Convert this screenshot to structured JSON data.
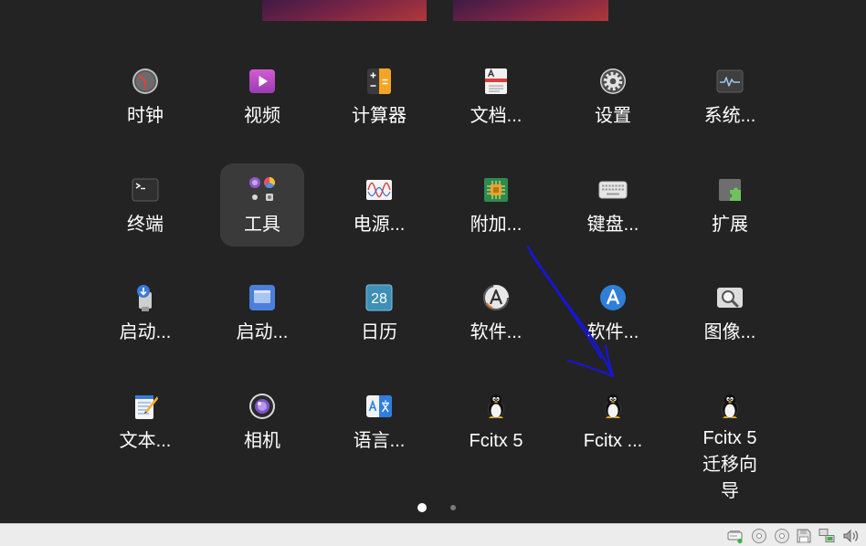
{
  "app_grid": {
    "apps": [
      {
        "label": "时钟",
        "icon": "clock-icon"
      },
      {
        "label": "视频",
        "icon": "videos-icon"
      },
      {
        "label": "计算器",
        "icon": "calculator-icon"
      },
      {
        "label": "文档...",
        "icon": "document-viewer-icon"
      },
      {
        "label": "设置",
        "icon": "settings-gear-icon"
      },
      {
        "label": "系统...",
        "icon": "system-monitor-icon"
      },
      {
        "label": "终端",
        "icon": "terminal-icon"
      },
      {
        "label": "工具",
        "icon": "folder-grid-icon",
        "highlighted": true
      },
      {
        "label": "电源...",
        "icon": "power-statistics-icon"
      },
      {
        "label": "附加...",
        "icon": "driver-chip-icon"
      },
      {
        "label": "键盘...",
        "icon": "keyboard-icon"
      },
      {
        "label": "扩展",
        "icon": "puzzle-extension-icon"
      },
      {
        "label": "启动...",
        "icon": "usb-disk-creator-icon"
      },
      {
        "label": "启动...",
        "icon": "startup-window-icon"
      },
      {
        "label": "日历",
        "icon": "calendar-icon",
        "icon_text": "28"
      },
      {
        "label": "软件...",
        "icon": "software-updater-icon"
      },
      {
        "label": "软件...",
        "icon": "software-store-icon"
      },
      {
        "label": "图像...",
        "icon": "image-viewer-icon"
      },
      {
        "label": "文本...",
        "icon": "text-editor-icon"
      },
      {
        "label": "相机",
        "icon": "camera-icon"
      },
      {
        "label": "语言...",
        "icon": "language-icon"
      },
      {
        "label": "Fcitx 5",
        "icon": "tux-penguin-icon"
      },
      {
        "label": "Fcitx ...",
        "icon": "tux-penguin-icon"
      },
      {
        "label": "Fcitx 5 迁移向导",
        "icon": "tux-penguin-icon"
      }
    ]
  },
  "page_indicator": {
    "pages": 2,
    "current": 1
  },
  "status_bar": {
    "icons": [
      "hard-disk-icon",
      "optical-disc-icon",
      "optical-disc-icon",
      "floppy-disk-icon",
      "network-icon",
      "speaker-icon"
    ]
  },
  "colors": {
    "background": "#232323",
    "tile_highlight": "#3a3a3a",
    "label": "#ffffff",
    "status_bar": "#ececec",
    "page_dot_active": "#ffffff",
    "page_dot_inactive": "#7a7a7a",
    "annotation_arrow": "#1616d6",
    "workspace_gradient": [
      "#3e1a45",
      "#7a2546",
      "#b0383a"
    ]
  }
}
